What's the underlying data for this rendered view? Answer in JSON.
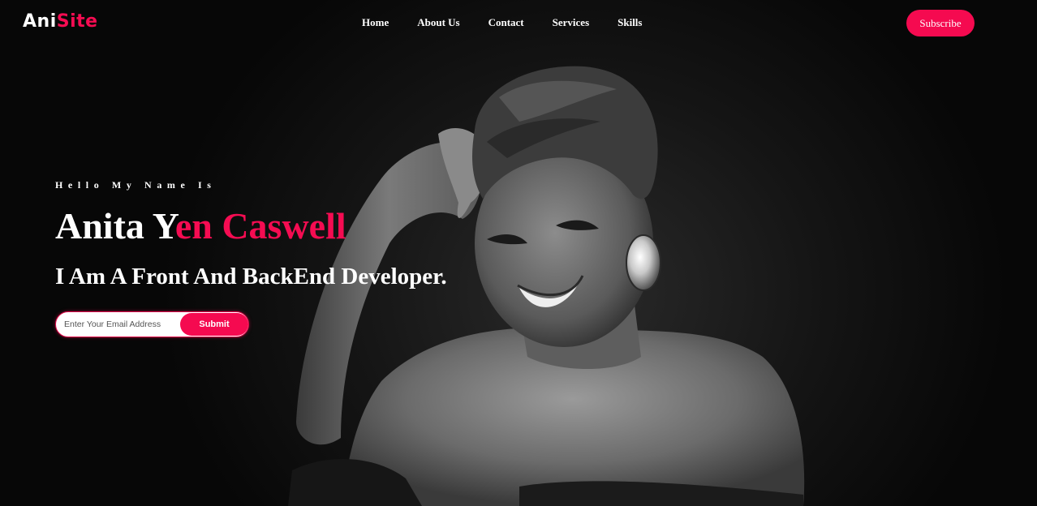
{
  "brand": {
    "logo_part1": "Ani",
    "logo_part2": "Site",
    "accent_color": "#f50c52"
  },
  "nav": {
    "items": [
      {
        "label": "Home"
      },
      {
        "label": "About Us"
      },
      {
        "label": "Contact"
      },
      {
        "label": "Services"
      },
      {
        "label": "Skills"
      }
    ],
    "subscribe_label": "Subscribe"
  },
  "hero": {
    "greeting": "Hello My Name Is",
    "name_white": "Anita Y",
    "name_pink": "en Caswell",
    "tagline": "I Am A Front And BackEnd Developer.",
    "email_placeholder": "Enter Your Email Address",
    "submit_label": "Submit",
    "image": "black-and-white portrait of smiling woman with head wrap and hoop earring"
  }
}
